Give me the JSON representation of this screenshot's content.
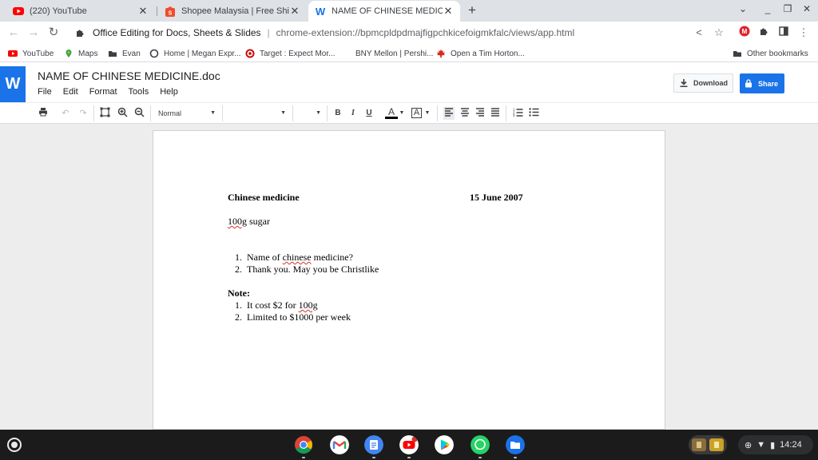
{
  "tabs": [
    {
      "title": "(220) YouTube",
      "icon": "youtube-icon",
      "color": "#ff0000"
    },
    {
      "title": "Shopee Malaysia | Free Shipping",
      "icon": "shopee-icon",
      "color": "#ee4d2d"
    },
    {
      "title": "NAME OF CHINESE MEDICINE.d",
      "icon": "word-icon",
      "color": "#1a73e8",
      "active": true
    }
  ],
  "address": {
    "site_name": "Office Editing for Docs, Sheets & Slides",
    "url": "chrome-extension://bpmcpldpdmajfigpchkicefoigmkfalc/views/app.html"
  },
  "bookmarks": [
    {
      "label": "YouTube",
      "icon": "youtube-icon"
    },
    {
      "label": "Maps",
      "icon": "maps-pin-icon"
    },
    {
      "label": "Evan",
      "icon": "folder-icon"
    },
    {
      "label": "Home | Megan Expr...",
      "icon": "circle-icon"
    },
    {
      "label": "Target : Expect Mor...",
      "icon": "target-icon"
    },
    {
      "label": "BNY Mellon | Pershi...",
      "icon": "none"
    },
    {
      "label": "Open a Tim Horton...",
      "icon": "maple-leaf-icon"
    },
    {
      "label": "Other bookmarks",
      "icon": "folder-icon"
    }
  ],
  "app": {
    "logo_letter": "W",
    "doc_title": "NAME OF CHINESE MEDICINE.doc",
    "menus": [
      "File",
      "Edit",
      "Format",
      "Tools",
      "Help"
    ],
    "download_label": "Download",
    "share_label": "Share"
  },
  "format_toolbar": {
    "style_value": "Normal",
    "bold": "B",
    "italic": "I",
    "underline": "U",
    "text_color_glyph": "A",
    "highlight_glyph": "A"
  },
  "document": {
    "heading_left": "Chinese medicine",
    "heading_right": "15 June 2007",
    "line_qty": "100g",
    "line_item": "sugar",
    "list1": [
      {
        "num": "1.",
        "pre": "Name of ",
        "spell": "chinese",
        "post": " medicine?"
      },
      {
        "num": "2.",
        "pre": "Thank you. May you be Christlike",
        "spell": "",
        "post": ""
      }
    ],
    "note_label": "Note:",
    "list2": [
      {
        "num": "1.",
        "pre": "It cost $2 for ",
        "spell": "100g",
        "post": ""
      },
      {
        "num": "2.",
        "pre": "Limited to $1000 per week",
        "spell": "",
        "post": ""
      }
    ]
  },
  "shelf": {
    "apps": [
      "chrome-icon",
      "gmail-icon",
      "docs-icon",
      "youtube-icon",
      "play-store-icon",
      "whatsapp-icon",
      "files-icon"
    ],
    "time": "14:24"
  }
}
